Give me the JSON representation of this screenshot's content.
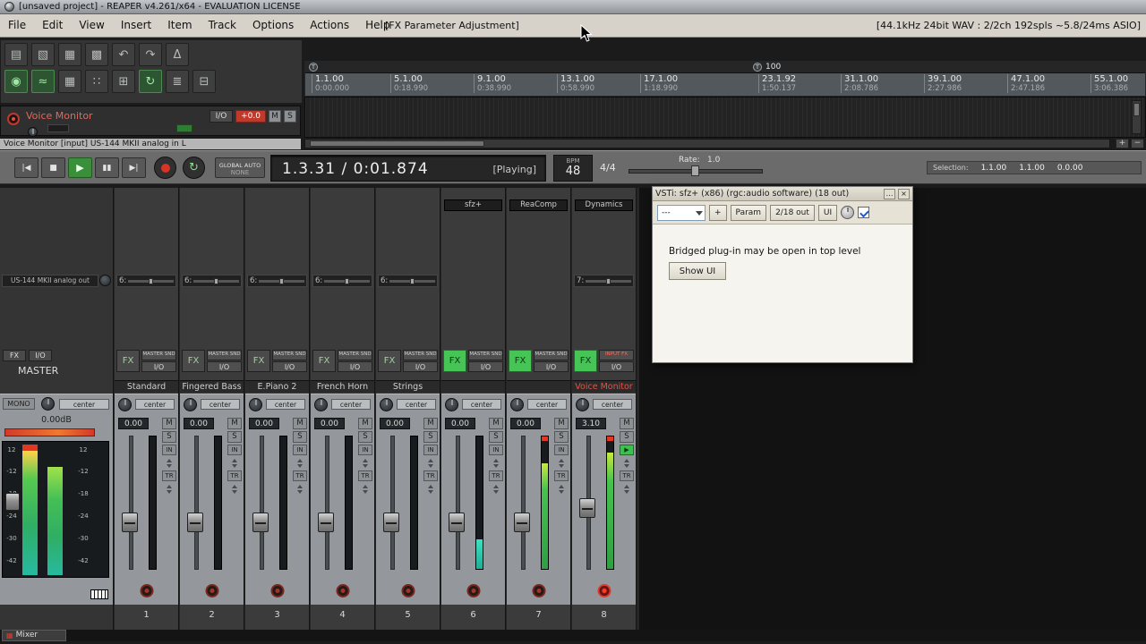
{
  "window": {
    "title": "[unsaved project] - REAPER v4.261/x64 - EVALUATION LICENSE"
  },
  "menubar": {
    "items": [
      "File",
      "Edit",
      "View",
      "Insert",
      "Item",
      "Track",
      "Options",
      "Actions",
      "Help"
    ],
    "center_status": "[FX Parameter Adjustment]",
    "right_status": "[44.1kHz 24bit WAV : 2/2ch 192spls ~5.8/24ms ASIO]"
  },
  "toolbar": {
    "row1": [
      {
        "name": "new-project",
        "glyph": "▤"
      },
      {
        "name": "open-project",
        "glyph": "▧"
      },
      {
        "name": "save-project",
        "glyph": "▦"
      },
      {
        "name": "project-settings",
        "glyph": "▩"
      },
      {
        "name": "undo",
        "glyph": "↶"
      },
      {
        "name": "redo",
        "glyph": "↷"
      },
      {
        "name": "metronome",
        "glyph": "Δ"
      }
    ],
    "row2": [
      {
        "name": "record-mode",
        "glyph": "◉",
        "active": true
      },
      {
        "name": "envelopes",
        "glyph": "≈",
        "active": true
      },
      {
        "name": "routing-matrix",
        "glyph": "▦"
      },
      {
        "name": "grid-lines",
        "glyph": "∷"
      },
      {
        "name": "snap",
        "glyph": "⊞"
      },
      {
        "name": "loop",
        "glyph": "↻",
        "active": true
      },
      {
        "name": "ripple-edit",
        "glyph": "≣"
      },
      {
        "name": "lock",
        "glyph": "⊟"
      }
    ]
  },
  "ruler": {
    "tempo_glyph": "T",
    "marker_label": "100",
    "ticks": [
      {
        "bar": "1.1.00",
        "time": "0:00.000"
      },
      {
        "bar": "5.1.00",
        "time": "0:18.990"
      },
      {
        "bar": "9.1.00",
        "time": "0:38.990"
      },
      {
        "bar": "13.1.00",
        "time": "0:58.990"
      },
      {
        "bar": "17.1.00",
        "time": "1:18.990"
      },
      {
        "bar": "23.1.92",
        "time": "1:50.137"
      },
      {
        "bar": "31.1.00",
        "time": "2:08.786"
      },
      {
        "bar": "39.1.00",
        "time": "2:27.986"
      },
      {
        "bar": "47.1.00",
        "time": "2:47.186"
      },
      {
        "bar": "55.1.00",
        "time": "3:06.386"
      }
    ]
  },
  "track_panel": {
    "name": "Voice Monitor",
    "io": "I/O",
    "volume": "+0.0",
    "mute": "M",
    "solo": "S",
    "status_line": "Voice Monitor [input] US-144 MKII analog in L"
  },
  "transport": {
    "buttons": [
      {
        "name": "go-to-start",
        "glyph": "|◀"
      },
      {
        "name": "stop",
        "glyph": "■"
      },
      {
        "name": "play",
        "glyph": "▶",
        "active": true
      },
      {
        "name": "pause",
        "glyph": "▮▮"
      },
      {
        "name": "go-to-end",
        "glyph": "▶|"
      }
    ],
    "repeat_glyph": "↻",
    "global_auto": "GLOBAL AUTO",
    "global_auto_state": "NONE",
    "time_display": "1.3.31 / 0:01.874",
    "play_state": "[Playing]",
    "bpm_label": "BPM",
    "bpm_value": "48",
    "time_signature": "4/4",
    "rate_label": "Rate:",
    "rate_value": "1.0",
    "selection_label": "Selection:",
    "selection_start": "1.1.00",
    "selection_end": "1.1.00",
    "selection_length": "0.0.00"
  },
  "fx_window": {
    "title": "VSTi: sfz+ (x86) (rgc:audio software) (18 out)",
    "dots_button": "…",
    "close_button": "×",
    "preset_value": "---",
    "add_button": "+",
    "param_button": "Param",
    "out_button": "2/18 out",
    "ui_button": "UI",
    "message": "Bridged plug-in may be open in top level",
    "show_ui_button": "Show UI"
  },
  "mixer": {
    "tab_label": "Mixer",
    "tab_glyph": "▦",
    "master": {
      "hw_out": "US-144 MKII analog out",
      "fx": "FX",
      "io": "I/O",
      "label": "MASTER",
      "mono": "MONO",
      "pan": "center",
      "readout": "0.00dB",
      "scale": [
        "12",
        "-12",
        "-18",
        "-24",
        "-30",
        "-42"
      ]
    },
    "channels": [
      {
        "num": "1",
        "name": "Standard",
        "insert": "",
        "send": "6:",
        "fx": "FX",
        "mini": "MASTER SND",
        "io": "I/O",
        "pan": "center",
        "vol": "0.00",
        "m": "M",
        "s": "S",
        "in": "IN",
        "tr": "TR",
        "meter": 0,
        "clip": false,
        "fx_active": false,
        "armed": false
      },
      {
        "num": "2",
        "name": "Fingered Bass",
        "insert": "",
        "send": "6:",
        "fx": "FX",
        "mini": "MASTER SND",
        "io": "I/O",
        "pan": "center",
        "vol": "0.00",
        "m": "M",
        "s": "S",
        "in": "IN",
        "tr": "TR",
        "meter": 0,
        "clip": false,
        "fx_active": false,
        "armed": false
      },
      {
        "num": "3",
        "name": "E.Piano 2",
        "insert": "",
        "send": "6:",
        "fx": "FX",
        "mini": "MASTER SND",
        "io": "I/O",
        "pan": "center",
        "vol": "0.00",
        "m": "M",
        "s": "S",
        "in": "IN",
        "tr": "TR",
        "meter": 0,
        "clip": false,
        "fx_active": false,
        "armed": false
      },
      {
        "num": "4",
        "name": "French Horn",
        "insert": "",
        "send": "6:",
        "fx": "FX",
        "mini": "MASTER SND",
        "io": "I/O",
        "pan": "center",
        "vol": "0.00",
        "m": "M",
        "s": "S",
        "in": "IN",
        "tr": "TR",
        "meter": 0,
        "clip": false,
        "fx_active": false,
        "armed": false
      },
      {
        "num": "5",
        "name": "Strings",
        "insert": "",
        "send": "6:",
        "fx": "FX",
        "mini": "MASTER SND",
        "io": "I/O",
        "pan": "center",
        "vol": "0.00",
        "m": "M",
        "s": "S",
        "in": "IN",
        "tr": "TR",
        "meter": 0,
        "clip": false,
        "fx_active": false,
        "armed": false
      },
      {
        "num": "6",
        "name": "",
        "insert": "sfz+",
        "send": "",
        "fx": "FX",
        "mini": "MASTER SND",
        "io": "I/O",
        "pan": "center",
        "vol": "0.00",
        "m": "M",
        "s": "S",
        "in": "IN",
        "tr": "TR",
        "meter": 0.22,
        "clip": false,
        "fx_active": true,
        "meter_teal": true,
        "armed": false
      },
      {
        "num": "7",
        "name": "",
        "insert": "ReaComp",
        "send": "",
        "fx": "FX",
        "mini": "MASTER SND",
        "io": "I/O",
        "pan": "center",
        "vol": "0.00",
        "m": "M",
        "s": "S",
        "in": "IN",
        "tr": "TR",
        "meter": 0.8,
        "clip": true,
        "fx_active": true,
        "armed": false
      },
      {
        "num": "8",
        "name": "Voice Monitor",
        "name_red": true,
        "insert": "Dynamics",
        "send": "7:",
        "fx": "FX",
        "mini": "INPUT FX",
        "mini_red": true,
        "io": "I/O",
        "pan": "center",
        "vol": "3.10",
        "m": "M",
        "s": "S",
        "in": "▶",
        "monitor": true,
        "tr": "TR",
        "meter": 0.88,
        "clip": true,
        "fx_active": true,
        "armed": true
      }
    ]
  }
}
